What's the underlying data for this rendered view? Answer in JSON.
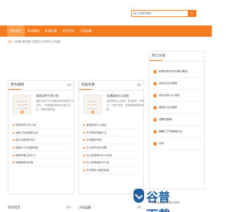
{
  "search": {
    "placeholder": "输入关键词搜索",
    "button_icon": "search-icon"
  },
  "nav": {
    "items": [
      {
        "label": "网站首页",
        "active": true
      },
      {
        "label": "草木植物",
        "active": false
      },
      {
        "label": "花园花事",
        "active": false
      },
      {
        "label": "花卉百艺",
        "active": false
      },
      {
        "label": "小窍益篇",
        "active": false
      }
    ]
  },
  "breadcrumb": {
    "home": "首页",
    "path": "> 伊桃庭·暖冬国风·花园生活·花卉养护·小窍益篇"
  },
  "panels": {
    "plants": {
      "title": "草木植物",
      "more": "更多",
      "feature_title": "银莲花种子多少钱",
      "feature_desc": "银莲花种子的价格受品种和种植方法影响，一般普通品种每包在数元左右，珍稀品种更高。",
      "items": [
        "银莲花种子多少钱",
        "海棠之前用薄荷玉米",
        "傻瓜也能种的吊兰",
        "盆栽什么东西能驱蚊",
        "栽种时要注意什么",
        "海棠酸菜如何栽"
      ]
    },
    "garden": {
      "title": "花园花事",
      "more": "更多",
      "feature_title": "金盏菊有什么用处",
      "feature_desc": "金盏菊别名山金菊，色彩鲜艳，花期长，可用于观赏、药用和庭院美化种植。",
      "items": [
        "金盏菊有什么用处",
        "天竺葵的养殖方法",
        "贝壳圆如何养",
        "白兰养护常见问题",
        "四川盆栽种花什么时候",
        "仙人掌养殖技巧介绍",
        "天竺葵怎么做好养殖"
      ]
    },
    "hot": {
      "title": "热门文章",
      "items": [
        {
          "num": "1",
          "text": "银莲花种子的价格与栽培"
        },
        {
          "num": "2",
          "text": "风仙花文化寓意"
        },
        {
          "num": "3",
          "text": "风仙花有什么讲究"
        },
        {
          "num": "4",
          "text": "黄百叶文化寓意"
        },
        {
          "num": "5",
          "text": "菠萝的繁殖"
        },
        {
          "num": "6",
          "text": "蝴蝶兰子的养殖方法"
        },
        {
          "num": "7",
          "text": "花市"
        }
      ]
    },
    "bottom_left": {
      "title": "花卉百艺",
      "more": "更多"
    },
    "bottom_right": {
      "title": "小窍益篇",
      "more": "更多"
    }
  },
  "watermark": {
    "main": "谷普下载",
    "sub": "www.gupuxia.com"
  }
}
